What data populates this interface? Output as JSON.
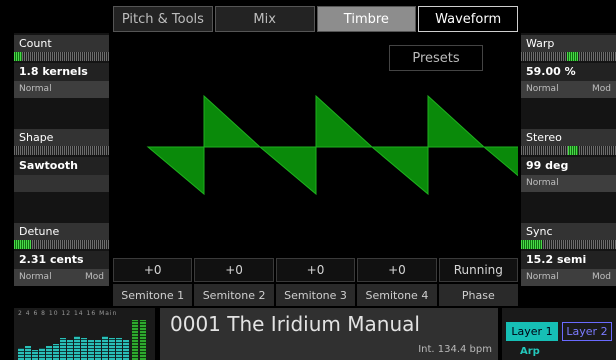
{
  "tabs": [
    {
      "label": "Pitch & Tools"
    },
    {
      "label": "Mix"
    },
    {
      "label": "Timbre"
    },
    {
      "label": "Waveform"
    }
  ],
  "left_params": [
    {
      "title": "Count",
      "meter_level": 0.08,
      "value": "1.8 kernels",
      "mode": "Normal",
      "mod": ""
    },
    {
      "title": "Shape",
      "meter_level": 0.0,
      "value": "Sawtooth",
      "mode": "",
      "mod": ""
    },
    {
      "title": "Detune",
      "meter_level": 0.18,
      "value": "2.31 cents",
      "mode": "Normal",
      "mod": "Mod"
    }
  ],
  "right_params": [
    {
      "title": "Warp",
      "meter_level_from": 0.48,
      "meter_level_to": 0.6,
      "value": "59.00 %",
      "mode": "Normal",
      "mod": "Mod"
    },
    {
      "title": "Stereo",
      "meter_level_from": 0.5,
      "meter_level_to": 0.6,
      "value": "99 deg",
      "mode": "Normal",
      "mod": ""
    },
    {
      "title": "Sync",
      "meter_level_from": 0.0,
      "meter_level_to": 0.22,
      "value": "15.2 semi",
      "mode": "Normal",
      "mod": "Mod"
    }
  ],
  "presets_label": "Presets",
  "waveform_color": "#0a8a0a",
  "slots": [
    {
      "value": "+0",
      "label": "Semitone 1"
    },
    {
      "value": "+0",
      "label": "Semitone 2"
    },
    {
      "value": "+0",
      "label": "Semitone 3"
    },
    {
      "value": "+0",
      "label": "Semitone 4"
    },
    {
      "value": "Running",
      "label": "Phase"
    }
  ],
  "vu": {
    "scale_text": "2   4   6   8  10  12  14  16  Main",
    "levels": [
      0.3,
      0.35,
      0.25,
      0.3,
      0.35,
      0.4,
      0.55,
      0.5,
      0.6,
      0.55,
      0.5,
      0.5,
      0.6,
      0.55,
      0.55,
      0.5
    ]
  },
  "patch": {
    "name": "0001 The Iridium Manual",
    "tempo": "Int. 134.4 bpm"
  },
  "layers": {
    "layer1": "Layer 1",
    "layer2": "Layer 2",
    "arp": "Arp"
  },
  "colors": {
    "accent_teal": "#16bfb5",
    "meter_green": "#49d949",
    "layer2_blue": "#6a6aff"
  }
}
